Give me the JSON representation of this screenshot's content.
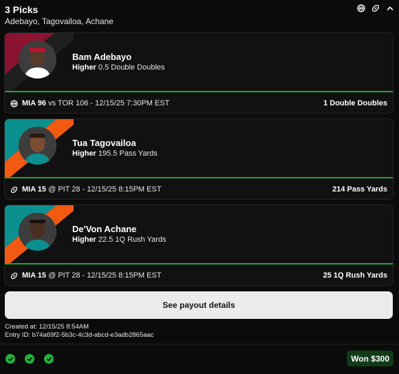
{
  "header": {
    "title": "3 Picks",
    "subtitle": "Adebayo, Tagovailoa, Achane",
    "icons": [
      "basketball-icon",
      "football-icon",
      "chevron-up-icon"
    ]
  },
  "picks": [
    {
      "player": "Bam Adebayo",
      "direction": "Higher",
      "line": "0.5 Double Doubles",
      "sport_icon": "basketball-icon",
      "team": "MIA 96",
      "matchup": "vs TOR 106 - 12/15/25 7:30PM EST",
      "result": "1 Double Doubles",
      "stripe_colors": [
        "#8a1330",
        "#1f1f1f"
      ]
    },
    {
      "player": "Tua Tagovailoa",
      "direction": "Higher",
      "line": "195.5 Pass Yards",
      "sport_icon": "football-icon",
      "team": "MIA 15",
      "matchup": "@ PIT 28 - 12/15/25 8:15PM EST",
      "result": "214 Pass Yards",
      "stripe_colors": [
        "#0c8f8f",
        "#f25a12"
      ]
    },
    {
      "player": "De'Von Achane",
      "direction": "Higher",
      "line": "22.5 1Q Rush Yards",
      "sport_icon": "football-icon",
      "team": "MIA 15",
      "matchup": "@ PIT 28 - 12/15/25 8:15PM EST",
      "result": "25 1Q Rush Yards",
      "stripe_colors": [
        "#0c8f8f",
        "#f25a12"
      ]
    }
  ],
  "payout_button": "See payout details",
  "meta": {
    "created": "Created at: 12/15/25 8:54AM",
    "entry_id": "Entry ID: b74a69f2-5b3c-4c3d-abcd-e3adb2865aac"
  },
  "footer": {
    "checks": 3,
    "result_badge": "Won $300"
  },
  "colors": {
    "win_green": "#22b13a",
    "line_green": "#22a832",
    "background": "#0b0b0b",
    "card": "#111111"
  }
}
